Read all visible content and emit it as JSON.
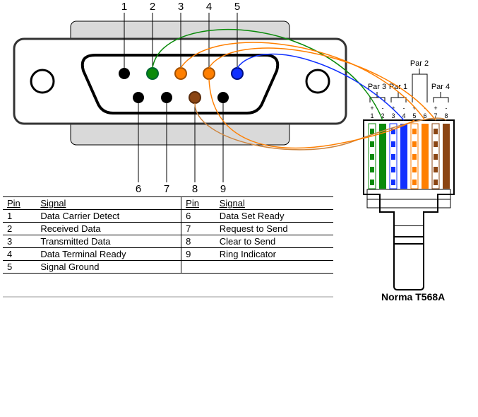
{
  "db9": {
    "pin_labels_top": [
      "1",
      "2",
      "3",
      "4",
      "5"
    ],
    "pin_labels_bot": [
      "6",
      "7",
      "8",
      "9"
    ]
  },
  "table": {
    "headers": [
      "Pin",
      "Signal",
      "Pin",
      "Signal"
    ],
    "rows": [
      [
        "1",
        "Data Carrier Detect",
        "6",
        "Data Set Ready"
      ],
      [
        "2",
        "Received Data",
        "7",
        "Request to Send"
      ],
      [
        "3",
        "Transmitted Data",
        "8",
        "Clear to Send"
      ],
      [
        "4",
        "Data  Terminal Ready",
        "9",
        "Ring Indicator"
      ],
      [
        "5",
        "Signal Ground",
        "",
        ""
      ]
    ]
  },
  "rj45": {
    "caption": "Norma T568A",
    "pairs": [
      "Par 3",
      "Par 1",
      "Par 2",
      "Par 4"
    ],
    "pair_pos_text": {
      "plus": "+",
      "minus": "-"
    },
    "pin_nums": [
      "1",
      "2",
      "3",
      "4",
      "5",
      "6",
      "7",
      "8"
    ]
  },
  "chart_data": {
    "type": "table",
    "title": "DB9 (RS-232) to RJ45 T568A wiring diagram",
    "db9_pinout": [
      {
        "pin": 1,
        "signal": "Data Carrier Detect",
        "color": "black"
      },
      {
        "pin": 2,
        "signal": "Received Data",
        "color": "green"
      },
      {
        "pin": 3,
        "signal": "Transmitted Data",
        "color": "orange"
      },
      {
        "pin": 4,
        "signal": "Data Terminal Ready",
        "color": "orange"
      },
      {
        "pin": 5,
        "signal": "Signal Ground",
        "color": "blue"
      },
      {
        "pin": 6,
        "signal": "Data Set Ready",
        "color": "black"
      },
      {
        "pin": 7,
        "signal": "Request to Send",
        "color": "black"
      },
      {
        "pin": 8,
        "signal": "Clear to Send",
        "color": "brown"
      },
      {
        "pin": 9,
        "signal": "Ring Indicator",
        "color": "black"
      }
    ],
    "rj45_t568a": [
      {
        "pin": 1,
        "pair": 3,
        "polarity": "+",
        "color": "white-green"
      },
      {
        "pin": 2,
        "pair": 3,
        "polarity": "-",
        "color": "green"
      },
      {
        "pin": 3,
        "pair": 1,
        "polarity": "+",
        "color": "white-blue"
      },
      {
        "pin": 4,
        "pair": 1,
        "polarity": "-",
        "color": "blue"
      },
      {
        "pin": 5,
        "pair": 2,
        "polarity": "+",
        "color": "white-orange"
      },
      {
        "pin": 6,
        "pair": 2,
        "polarity": "-",
        "color": "orange"
      },
      {
        "pin": 7,
        "pair": 4,
        "polarity": "+",
        "color": "white-brown"
      },
      {
        "pin": 8,
        "pair": 4,
        "polarity": "-",
        "color": "brown"
      }
    ],
    "wires_db9_to_rj45": [
      {
        "db9": 2,
        "rj45": 2,
        "color": "green"
      },
      {
        "db9": 3,
        "rj45": 6,
        "color": "orange"
      },
      {
        "db9": 4,
        "rj45": 7,
        "color": "orange"
      },
      {
        "db9": 5,
        "rj45": 4,
        "color": "blue"
      },
      {
        "db9": 8,
        "rj45": 8,
        "color": "brown"
      }
    ]
  }
}
